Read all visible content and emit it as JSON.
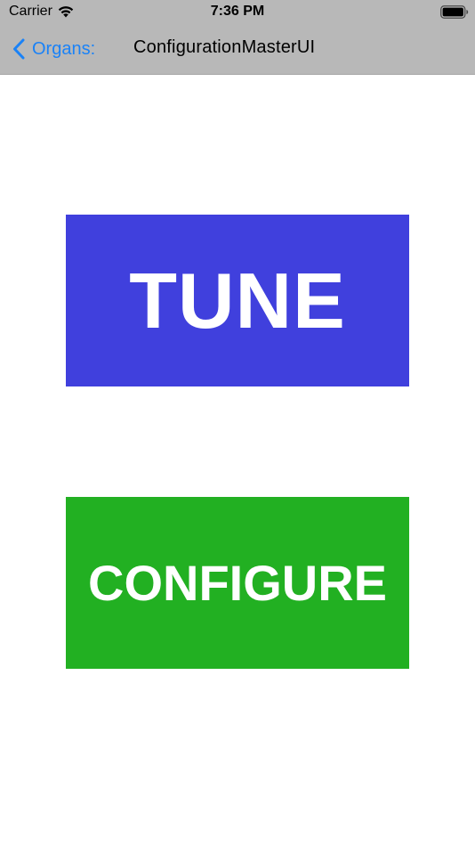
{
  "status_bar": {
    "carrier": "Carrier",
    "time": "7:36 PM",
    "wifi_icon": "wifi-icon",
    "battery_icon": "battery-icon"
  },
  "nav_bar": {
    "back_label": "Organs:",
    "title": "ConfigurationMasterUI",
    "back_icon": "chevron-left-icon"
  },
  "main": {
    "tune_label": "TUNE",
    "configure_label": "CONFIGURE"
  },
  "colors": {
    "nav_background": "#b8b8b8",
    "link_blue": "#1a82f7",
    "tune_button": "#4040dd",
    "configure_button": "#22b022",
    "button_text": "#ffffff"
  }
}
